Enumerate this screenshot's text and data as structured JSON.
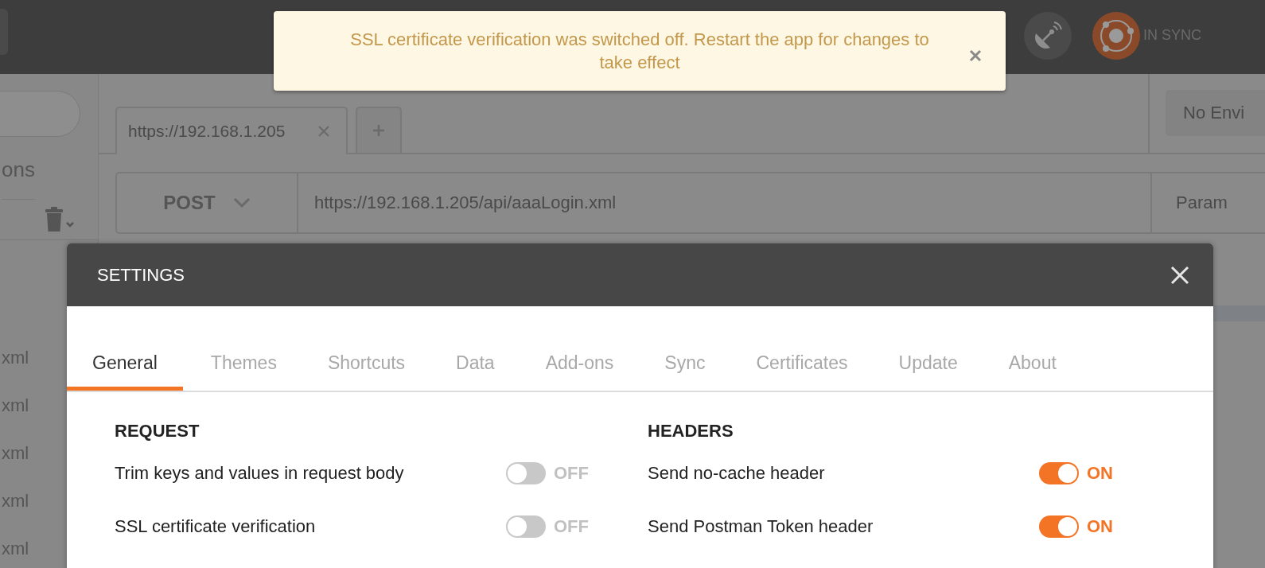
{
  "top_bar": {
    "sync_status": "IN SYNC"
  },
  "toast": {
    "message": "SSL certificate verification was switched off. Restart the app for changes to take effect"
  },
  "sidebar": {
    "section_fragment": "ons",
    "items": [
      "xml",
      "xml",
      "xml",
      "xml",
      "xml"
    ]
  },
  "request_tab": {
    "title": "https://192.168.1.205"
  },
  "environment": {
    "label": "No Envi"
  },
  "request": {
    "method": "POST",
    "url": "https://192.168.1.205/api/aaaLogin.xml",
    "params_label": "Param"
  },
  "settings": {
    "title": "SETTINGS",
    "tabs": [
      {
        "label": "General",
        "selected": true
      },
      {
        "label": "Themes",
        "selected": false
      },
      {
        "label": "Shortcuts",
        "selected": false
      },
      {
        "label": "Data",
        "selected": false
      },
      {
        "label": "Add-ons",
        "selected": false
      },
      {
        "label": "Sync",
        "selected": false
      },
      {
        "label": "Certificates",
        "selected": false
      },
      {
        "label": "Update",
        "selected": false
      },
      {
        "label": "About",
        "selected": false
      }
    ],
    "sections": [
      {
        "title": "REQUEST",
        "options": [
          {
            "label": "Trim keys and values in request body",
            "on": false,
            "state_text": "OFF"
          },
          {
            "label": "SSL certificate verification",
            "on": false,
            "state_text": "OFF"
          }
        ]
      },
      {
        "title": "HEADERS",
        "options": [
          {
            "label": "Send no-cache header",
            "on": true,
            "state_text": "ON"
          },
          {
            "label": "Send Postman Token header",
            "on": true,
            "state_text": "ON"
          }
        ]
      }
    ]
  }
}
